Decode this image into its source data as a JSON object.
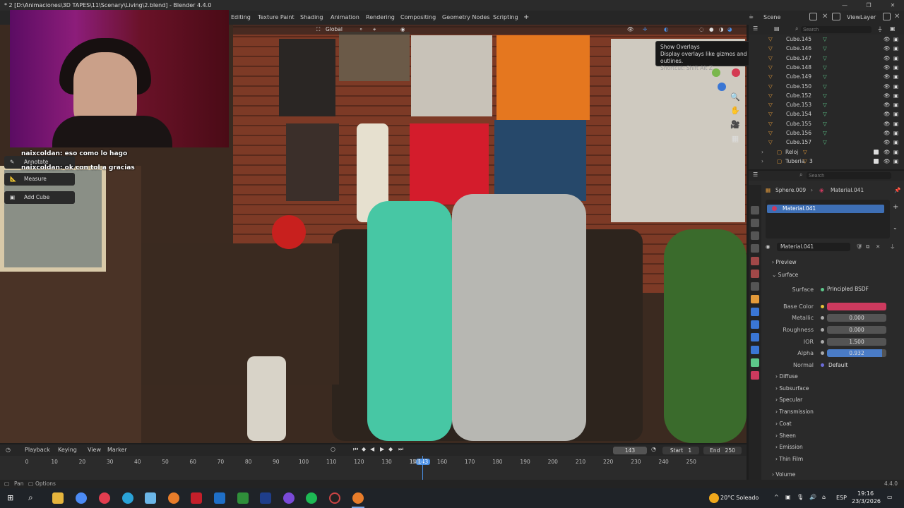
{
  "window": {
    "title": "* 2 [D:\\Animaciones\\3D TAPES\\11\\Scenary\\Living\\2.blend] - Blender 4.4.0",
    "minimize": "—",
    "maximize": "❐",
    "close": "✕"
  },
  "workspaces": [
    "Editing",
    "Texture Paint",
    "Shading",
    "Animation",
    "Rendering",
    "Compositing",
    "Geometry Nodes",
    "Scripting"
  ],
  "add_workspace": "+",
  "scene": {
    "label": "Scene",
    "view_layer": "ViewLayer"
  },
  "viewport": {
    "transform_orientation": "Global",
    "tooltip": {
      "title": "Show Overlays",
      "description": "Display overlays like gizmos and outlines.",
      "shortcut": "Shortcut: Shift Alt Z"
    }
  },
  "chat": [
    {
      "user": "naixcoldan:",
      "message": "eso como lo hago"
    },
    {
      "user": "naixcoldan:",
      "message": "ok con tol a gracias"
    }
  ],
  "tools": [
    {
      "label": "Annotate",
      "icon": "annotate-icon"
    },
    {
      "label": "Measure",
      "icon": "measure-icon"
    },
    {
      "label": "Add Cube",
      "icon": "add-cube-icon"
    }
  ],
  "outliner": {
    "search_placeholder": "Search",
    "rows": [
      {
        "name": "Cube.145",
        "type": "mesh"
      },
      {
        "name": "Cube.146",
        "type": "mesh"
      },
      {
        "name": "Cube.147",
        "type": "mesh"
      },
      {
        "name": "Cube.148",
        "type": "mesh"
      },
      {
        "name": "Cube.149",
        "type": "mesh"
      },
      {
        "name": "Cube.150",
        "type": "mesh"
      },
      {
        "name": "Cube.152",
        "type": "mesh"
      },
      {
        "name": "Cube.153",
        "type": "mesh"
      },
      {
        "name": "Cube.154",
        "type": "mesh"
      },
      {
        "name": "Cube.155",
        "type": "mesh"
      },
      {
        "name": "Cube.156",
        "type": "mesh"
      },
      {
        "name": "Cube.157",
        "type": "mesh"
      },
      {
        "name": "Reloj",
        "type": "collection"
      },
      {
        "name": "Tuberia",
        "type": "collection",
        "count": "3"
      }
    ]
  },
  "properties": {
    "search_placeholder": "Search",
    "breadcrumb_object": "Sphere.009",
    "breadcrumb_material": "Material.041",
    "slot_name": "Material.041",
    "material_name": "Material.041",
    "sections": {
      "preview": "Preview",
      "surface": "Surface"
    },
    "surface": {
      "surface_label": "Surface",
      "surface_value": "Principled BSDF",
      "base_color_label": "Base Color",
      "base_color": "#cc3a5e",
      "metallic_label": "Metallic",
      "metallic": "0.000",
      "roughness_label": "Roughness",
      "roughness": "0.000",
      "ior_label": "IOR",
      "ior": "1.500",
      "alpha_label": "Alpha",
      "alpha": "0.932",
      "normal_label": "Normal",
      "normal": "Default"
    },
    "subsections": [
      "Diffuse",
      "Subsurface",
      "Specular",
      "Transmission",
      "Coat",
      "Sheen",
      "Emission",
      "Thin Film"
    ],
    "volume": "Volume"
  },
  "timeline": {
    "menus": [
      "Playback",
      "Keying",
      "View",
      "Marker"
    ],
    "current_frame": "143",
    "start_label": "Start",
    "start": "1",
    "end_label": "End",
    "end": "250",
    "ticks": [
      "0",
      "10",
      "20",
      "30",
      "40",
      "50",
      "60",
      "70",
      "80",
      "90",
      "100",
      "110",
      "120",
      "130",
      "14",
      "143",
      "150",
      "160",
      "170",
      "180",
      "190",
      "200",
      "210",
      "220",
      "230",
      "240",
      "250"
    ]
  },
  "statusbar": {
    "left1": "Pan",
    "left2": "Options",
    "version": "4.4.0"
  },
  "taskbar": {
    "weather": "20°C Soleado",
    "lang": "ESP",
    "time": "19:16",
    "date": "23/3/2026"
  }
}
